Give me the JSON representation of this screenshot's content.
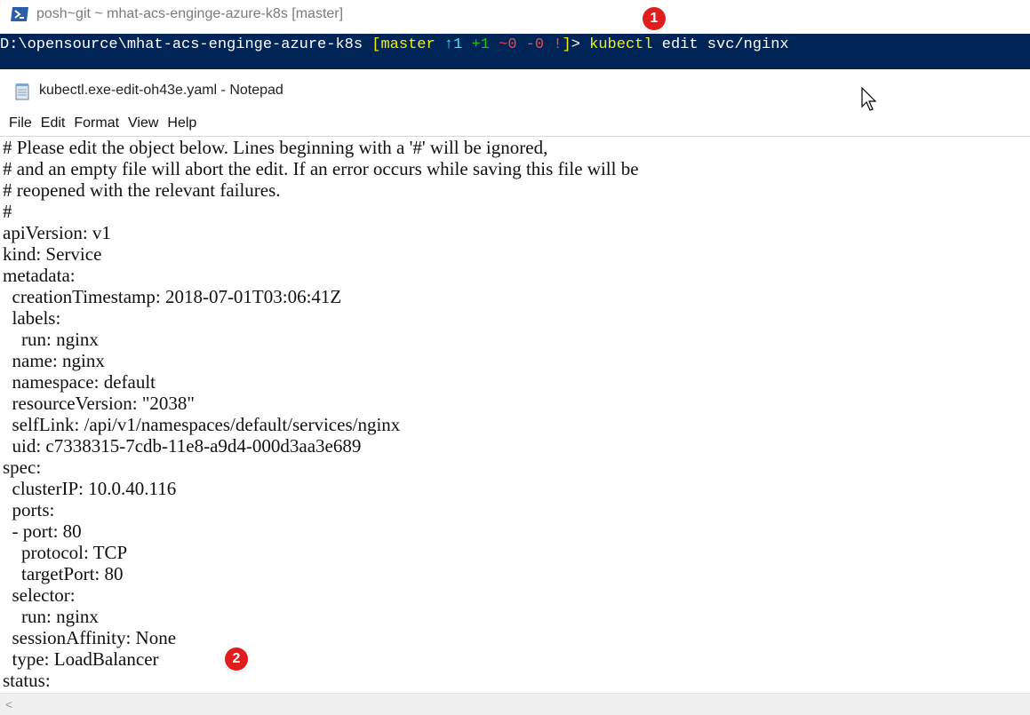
{
  "powershell": {
    "title": "posh~git ~ mhat-acs-enginge-azure-k8s [master]",
    "prompt": {
      "path": "D:\\opensource\\mhat-acs-enginge-azure-k8s",
      "space": " ",
      "branch_open": "[master",
      "ahead": " ↑1",
      "staged_add": " +1",
      "tilde": " ~",
      "staged_mod": "0",
      "staged_del": " -0",
      "bang": " !",
      "branch_close": "]",
      "arrow": "> ",
      "command": "kubectl",
      "args": " edit svc/nginx"
    }
  },
  "notepad": {
    "title": "kubectl.exe-edit-oh43e.yaml - Notepad",
    "menu": [
      "File",
      "Edit",
      "Format",
      "View",
      "Help"
    ],
    "lines": [
      "# Please edit the object below. Lines beginning with a '#' will be ignored,",
      "# and an empty file will abort the edit. If an error occurs while saving this file will be",
      "# reopened with the relevant failures.",
      "#",
      "apiVersion: v1",
      "kind: Service",
      "metadata:",
      "  creationTimestamp: 2018-07-01T03:06:41Z",
      "  labels:",
      "    run: nginx",
      "  name: nginx",
      "  namespace: default",
      "  resourceVersion: \"2038\"",
      "  selfLink: /api/v1/namespaces/default/services/nginx",
      "  uid: c7338315-7cdb-11e8-a9d4-000d3aa3e689",
      "spec:",
      "  clusterIP: 10.0.40.116",
      "  ports:",
      "  - port: 80",
      "    protocol: TCP",
      "    targetPort: 80",
      "  selector:",
      "    run: nginx",
      "  sessionAffinity: None",
      "  type: LoadBalancer",
      "status:"
    ]
  },
  "annotations": {
    "badge1": "1",
    "badge2": "2"
  },
  "icons": {
    "powershell": "powershell-icon",
    "notepad": "notepad-icon",
    "cursor": "mouse-cursor-icon",
    "scroll_left": "scroll-left-arrow-icon"
  },
  "scrollbar": {
    "left_arrow": "<"
  },
  "colors": {
    "ps_background": "#012456",
    "badge": "#e01e1e",
    "git_branch": "#f1f100",
    "git_ahead": "#3ae6ff",
    "git_added": "#16c60c",
    "git_changes": "#e74856"
  }
}
